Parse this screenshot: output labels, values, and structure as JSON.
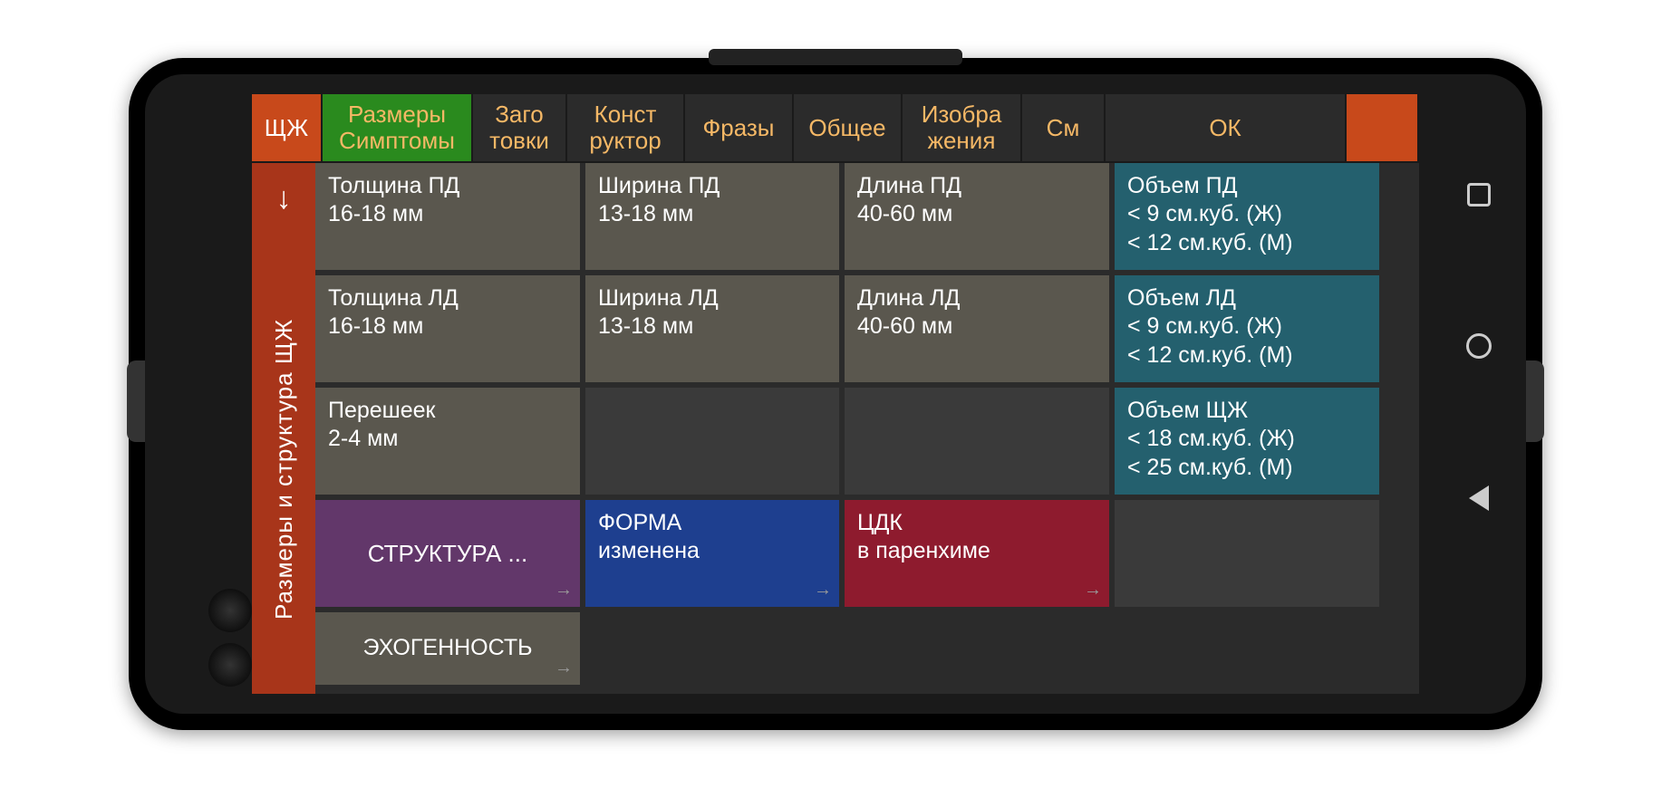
{
  "tabs": {
    "t0": "ЩЖ",
    "t1": "Размеры\nСимптомы",
    "t2": "Заго\nтовки",
    "t3": "Конст\nруктор",
    "t4": "Фразы",
    "t5": "Общее",
    "t6": "Изобра\nжения",
    "t7": "См",
    "t8": "ОК"
  },
  "sidebar": {
    "arrow": "↓",
    "label": "Размеры  и  структура  ЩЖ"
  },
  "grid": {
    "r1c1": {
      "t": "Толщина ПД",
      "s": "16-18 мм"
    },
    "r1c2": {
      "t": "Ширина ПД",
      "s": "13-18 мм"
    },
    "r1c3": {
      "t": "Длина ПД",
      "s": "40-60 мм"
    },
    "r1c4": {
      "t": "Объем ПД",
      "s": "< 9 см.куб.   (Ж)\n< 12 см.куб. (М)"
    },
    "r2c1": {
      "t": "Толщина ЛД",
      "s": "16-18 мм"
    },
    "r2c2": {
      "t": "Ширина ЛД",
      "s": "13-18 мм"
    },
    "r2c3": {
      "t": "Длина ЛД",
      "s": "40-60 мм"
    },
    "r2c4": {
      "t": "Объем ЛД",
      "s": "< 9 см.куб.   (Ж)\n< 12 см.куб. (М)"
    },
    "r3c1": {
      "t": "Перешеек",
      "s": "2-4 мм"
    },
    "r3c4": {
      "t": "Объем ЩЖ",
      "s": "< 18 см.куб. (Ж)\n< 25 см.куб. (М)"
    },
    "r4c1": {
      "t": "СТРУКТУРА ..."
    },
    "r4c2": {
      "t": "ФОРМА",
      "s": "изменена"
    },
    "r4c3": {
      "t": "ЦДК",
      "s": "в паренхиме"
    },
    "r5c1": {
      "t": "ЭХОГЕННОСТЬ"
    }
  }
}
